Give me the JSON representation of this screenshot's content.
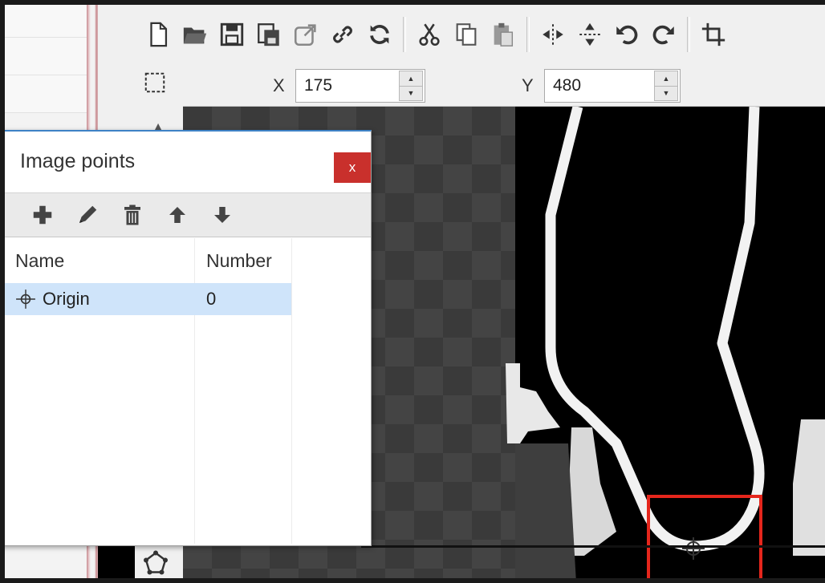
{
  "toolbar": {
    "buttons": [
      {
        "icon": "new-file-icon"
      },
      {
        "icon": "open-folder-icon"
      },
      {
        "icon": "save-icon"
      },
      {
        "icon": "save-all-icon"
      },
      {
        "icon": "export-icon"
      },
      {
        "icon": "link-icon"
      },
      {
        "icon": "refresh-icon"
      },
      {
        "icon": "cut-icon"
      },
      {
        "icon": "copy-icon"
      },
      {
        "icon": "paste-icon"
      },
      {
        "icon": "flip-horizontal-icon"
      },
      {
        "icon": "flip-vertical-icon"
      },
      {
        "icon": "rotate-left-icon"
      },
      {
        "icon": "rotate-right-icon"
      },
      {
        "icon": "crop-icon"
      }
    ],
    "x_label": "X",
    "x_value": "175",
    "y_label": "Y",
    "y_value": "480"
  },
  "dialog": {
    "title": "Image points",
    "close_label": "x",
    "tools": [
      "add-icon",
      "edit-icon",
      "delete-icon",
      "move-up-icon",
      "move-down-icon"
    ],
    "columns": [
      "Name",
      "Number"
    ],
    "rows": [
      {
        "name": "Origin",
        "number": "0",
        "icon": "crosshair-icon",
        "selected": true
      }
    ]
  },
  "colors": {
    "selection_rect": "#e5261c",
    "row_selected": "#cfe4fa",
    "close_button": "#c9302c"
  }
}
